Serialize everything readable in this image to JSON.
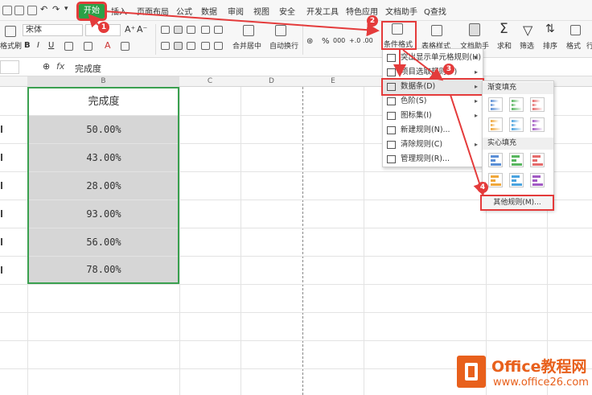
{
  "menubar": {
    "tabs": [
      "开始",
      "插入",
      "页面布局",
      "公式",
      "数据",
      "审阅",
      "视图",
      "安全",
      "开发工具",
      "特色应用",
      "文档助手"
    ],
    "search": "Q查找"
  },
  "ribbon": {
    "format_painter": "格式刷",
    "font_name": "宋体",
    "merge_center": "合并居中",
    "wrap_text": "自动换行",
    "cond_format": "条件格式",
    "table_style": "表格样式",
    "doc_helper": "文档助手",
    "sum": "求和",
    "filter": "筛选",
    "sort": "排序",
    "format": "格式",
    "row": "行"
  },
  "formula_bar": {
    "fx": "fx",
    "value": "完成度"
  },
  "sheet": {
    "columns": [
      "B",
      "C",
      "D",
      "E"
    ],
    "header": "完成度",
    "values": [
      "50.00%",
      "43.00%",
      "28.00%",
      "93.00%",
      "56.00%",
      "78.00%"
    ]
  },
  "cf_menu": {
    "items": [
      {
        "label": "突出显示单元格规则(H)",
        "arrow": "▸"
      },
      {
        "label": "项目选取规则(T)",
        "arrow": "▸"
      },
      {
        "label": "数据条(D)",
        "arrow": "▸"
      },
      {
        "label": "色阶(S)",
        "arrow": "▸"
      },
      {
        "label": "图标集(I)",
        "arrow": "▸"
      },
      {
        "label": "新建规则(N)...",
        "arrow": ""
      },
      {
        "label": "清除规则(C)",
        "arrow": "▸"
      },
      {
        "label": "管理规则(R)...",
        "arrow": ""
      }
    ]
  },
  "databar_menu": {
    "gradient_title": "渐变填充",
    "solid_title": "实心填充",
    "other_rules": "其他规则(M)..."
  },
  "swatch_colors": [
    "#5b8fd6",
    "#58b65f",
    "#e56b6b",
    "#f0a73b",
    "#4aa3df",
    "#a25ac4"
  ],
  "markers": [
    "1",
    "2",
    "3",
    "4"
  ],
  "logo": {
    "title": "Office教程网",
    "url": "www.office26.com"
  },
  "colors": {
    "accent_green": "#2aa147",
    "annotation_red": "#e43b3b",
    "brand_orange": "#e8601c"
  }
}
